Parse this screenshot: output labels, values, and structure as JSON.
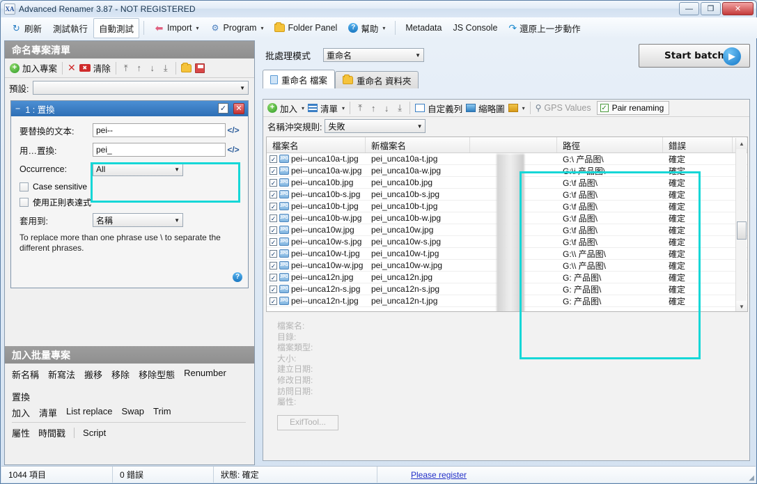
{
  "window": {
    "title": "Advanced Renamer 3.87 - NOT REGISTERED",
    "app_icon": "XA",
    "minimize": "—",
    "maximize": "❐",
    "close": "✕"
  },
  "menubar": [
    {
      "label": "刷新",
      "icon": "refresh-icon"
    },
    {
      "label": "測試執行",
      "icon": ""
    },
    {
      "label": "自動測試",
      "icon": ""
    },
    {
      "label": "Import",
      "icon": "import-icon",
      "caret": "▾"
    },
    {
      "label": "Program",
      "icon": "program-icon",
      "caret": "▾"
    },
    {
      "label": "Folder Panel",
      "icon": "folder-icon"
    },
    {
      "label": "幫助",
      "icon": "help-icon",
      "caret": "▾"
    },
    {
      "label": "Metadata",
      "icon": ""
    },
    {
      "label": "JS Console",
      "icon": ""
    },
    {
      "label": "還原上一步動作",
      "icon": "undo-icon"
    }
  ],
  "left_panel": {
    "section_title": "命名專案清單",
    "toolbar": {
      "add_project": "加入專案",
      "clear": "清除",
      "x_mark": "✕",
      "arrows": [
        "⤒",
        "↑",
        "↓",
        "⤓"
      ],
      "open_icon": "folder-open-icon",
      "save_icon": "save-icon"
    },
    "preset": {
      "label": "預設:",
      "value": "",
      "caret": "▼"
    },
    "rule": {
      "header": "1 : 置換",
      "collapse": "−",
      "enabled_check": "✓",
      "close": "✕",
      "fields": [
        {
          "label": "要替換的文本:",
          "value": "pei--",
          "code_btn": "</>"
        },
        {
          "label": "用…置換:",
          "value": "pei_",
          "code_btn": "</>"
        }
      ],
      "occurrence": {
        "label": "Occurrence:",
        "value": "All",
        "caret": "▼"
      },
      "case_sensitive": "Case sensitive",
      "use_regex": "使用正則表達式",
      "apply_to": {
        "label": "套用到:",
        "value": "名稱",
        "caret": "▼"
      },
      "hint": "To replace more than one phrase use \\ to separate the different phrases.",
      "help": "?"
    },
    "add_batch": {
      "section_title": "加入批量專案",
      "row1": [
        "新名稱",
        "新寫法",
        "搬移",
        "移除",
        "移除型態",
        "Renumber",
        "置換"
      ],
      "row2": [
        "加入",
        "清單",
        "List replace",
        "Swap",
        "Trim"
      ],
      "row3": [
        "屬性",
        "時間戳",
        "Script"
      ]
    }
  },
  "right_panel": {
    "batch_mode": {
      "label": "批處理模式",
      "value": "重命名",
      "caret": "▼"
    },
    "start_batch": {
      "label": "Start batch",
      "play": "▶"
    },
    "tabs": [
      {
        "label": "重命名 檔案",
        "icon": "document-icon",
        "active": true
      },
      {
        "label": "重命名 資料夾",
        "icon": "folder-icon",
        "active": false
      }
    ],
    "list_toolbar": {
      "add": "加入",
      "add_caret": "▾",
      "list": "清單",
      "list_caret": "▾",
      "arrows": [
        "⤒",
        "↑",
        "↓",
        "⤓"
      ],
      "custom_columns": "自定義列",
      "thumbnails": "縮略圖",
      "sort_caret": "▾",
      "gps_values": "GPS Values",
      "pair_renaming": "Pair renaming",
      "pair_check": "✓"
    },
    "conflict": {
      "label": "名稱沖突規則:",
      "value": "失敗",
      "caret": "▼"
    },
    "table": {
      "columns": [
        "檔案名",
        "新檔案名",
        "",
        "路徑",
        "錯誤",
        ""
      ],
      "rows": [
        {
          "checked": "✓",
          "icon": "jpg-icon",
          "old": "pei--unca10a-t.jpg",
          "new": "pei_unca10a-t.jpg",
          "path": "G:\\           产品图\\",
          "error": "確定"
        },
        {
          "checked": "✓",
          "icon": "jpg-icon",
          "old": "pei--unca10a-w.jpg",
          "new": "pei_unca10a-w.jpg",
          "path": "G:\\i          产品图\\",
          "error": "確定"
        },
        {
          "checked": "✓",
          "icon": "jpg-icon",
          "old": "pei--unca10b.jpg",
          "new": "pei_unca10b.jpg",
          "path": "G:\\f          品图\\",
          "error": "確定"
        },
        {
          "checked": "✓",
          "icon": "jpg-icon",
          "old": "pei--unca10b-s.jpg",
          "new": "pei_unca10b-s.jpg",
          "path": "G:\\f          品图\\",
          "error": "確定"
        },
        {
          "checked": "✓",
          "icon": "jpg-icon",
          "old": "pei--unca10b-t.jpg",
          "new": "pei_unca10b-t.jpg",
          "path": "G:\\f          品图\\",
          "error": "確定"
        },
        {
          "checked": "✓",
          "icon": "jpg-icon",
          "old": "pei--unca10b-w.jpg",
          "new": "pei_unca10b-w.jpg",
          "path": "G:\\f          品图\\",
          "error": "確定"
        },
        {
          "checked": "✓",
          "icon": "jpg-icon",
          "old": "pei--unca10w.jpg",
          "new": "pei_unca10w.jpg",
          "path": "G:\\f          品图\\",
          "error": "確定"
        },
        {
          "checked": "✓",
          "icon": "jpg-icon",
          "old": "pei--unca10w-s.jpg",
          "new": "pei_unca10w-s.jpg",
          "path": "G:\\f          品图\\",
          "error": "確定"
        },
        {
          "checked": "✓",
          "icon": "jpg-icon",
          "old": "pei--unca10w-t.jpg",
          "new": "pei_unca10w-t.jpg",
          "path": "G:\\\\         产品图\\",
          "error": "確定"
        },
        {
          "checked": "✓",
          "icon": "jpg-icon",
          "old": "pei--unca10w-w.jpg",
          "new": "pei_unca10w-w.jpg",
          "path": "G:\\\\         产品图\\",
          "error": "確定"
        },
        {
          "checked": "✓",
          "icon": "jpg-icon",
          "old": "pei--unca12n.jpg",
          "new": "pei_unca12n.jpg",
          "path": "G:           产品图\\",
          "error": "確定"
        },
        {
          "checked": "✓",
          "icon": "jpg-icon",
          "old": "pei--unca12n-s.jpg",
          "new": "pei_unca12n-s.jpg",
          "path": "G:           产品图\\",
          "error": "確定"
        },
        {
          "checked": "✓",
          "icon": "jpg-icon",
          "old": "pei--unca12n-t.jpg",
          "new": "pei_unca12n-t.jpg",
          "path": "G:           产品图\\",
          "error": "確定"
        }
      ],
      "scroll_up": "▲",
      "scroll_down": "▼"
    },
    "metadata": {
      "fields": [
        "檔案名:",
        "目錄:",
        "檔案類型:",
        "大小:",
        "建立日期:",
        "修改日期:",
        "訪問日期:",
        "屬性:"
      ],
      "exiftool_button": "ExifTool..."
    }
  },
  "status_bar": {
    "items": "1044 項目",
    "errors": "0 錯誤",
    "status": "狀態: 確定",
    "register_link": "Please register"
  },
  "colors": {
    "highlight": "#16d7d7",
    "rule_header": "#2e6fb5",
    "section_header": "#939393",
    "link": "#2330c8"
  }
}
